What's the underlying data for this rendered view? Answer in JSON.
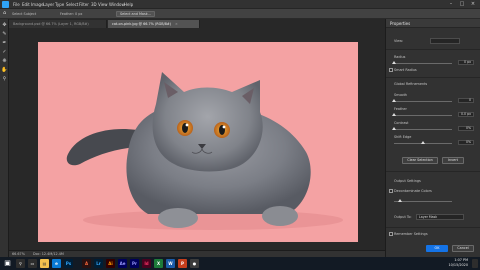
{
  "menubar": {
    "items": [
      "File",
      "Edit",
      "Image",
      "Layer",
      "Type",
      "Select",
      "Filter",
      "3D",
      "View",
      "Window",
      "Help"
    ]
  },
  "optionsbar": {
    "mode": "Select Subject",
    "feather": "Feather: 0 px",
    "button": "Select and Mask..."
  },
  "tabs": [
    {
      "label": "Background.psd @ 66.7% (Layer 1, RGB/8#)"
    },
    {
      "label": "cat-on-pink.jpg @ 66.7% (RGB/8#)"
    }
  ],
  "status": {
    "zoom": "66.67%",
    "doc": "Doc: 12.4M/12.4M"
  },
  "properties": {
    "title": "Properties",
    "view_mode_label": "View:",
    "radius_label": "Radius",
    "radius_value": "0 px",
    "smart_radius": "Smart Radius",
    "global_refinements": "Global Refinements",
    "smooth_label": "Smooth",
    "smooth_value": "0",
    "feather_label": "Feather",
    "feather_value": "0.0 px",
    "contrast_label": "Contrast",
    "contrast_value": "0%",
    "shift_edge_label": "Shift Edge",
    "shift_edge_value": "0%",
    "clear_selection": "Clear Selection",
    "invert": "Invert",
    "output_settings": "Output Settings",
    "decontaminate": "Decontaminate Colors",
    "output_to_label": "Output To:",
    "output_to_value": "Layer Mask",
    "remember": "Remember Settings",
    "ok": "OK",
    "cancel": "Cancel"
  },
  "taskbar": {
    "time": "1:07 PM",
    "date": "10/15/2020"
  },
  "colors": {
    "artboard": "#f4a2a3",
    "accent": "#1473e6",
    "ps_blue": "#2fa3f7"
  }
}
